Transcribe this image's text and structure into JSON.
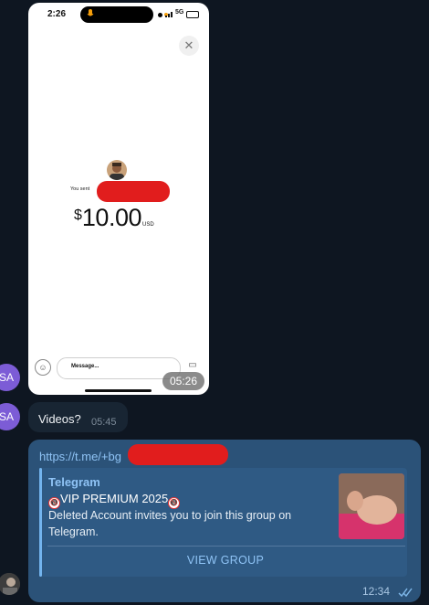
{
  "screenshot": {
    "status_time": "2:26",
    "network": "5G",
    "close_icon": "close-icon",
    "you_sent_label": "You sent",
    "currency_symbol": "$",
    "amount": "10.00",
    "currency_code": "USD",
    "message_placeholder": "Message...",
    "timestamp": "05:26"
  },
  "avatars": {
    "sa_initials_1": "SA",
    "sa_initials_2": "SA"
  },
  "message_videos": {
    "text": "Videos?",
    "time": "05:45"
  },
  "link_message": {
    "url_prefix": "https://t.me/+bg",
    "preview": {
      "site": "Telegram",
      "badge": "🔞",
      "title": "VIP PREMIUM 2025",
      "description": "Deleted Account invites you to join this group on Telegram.",
      "action": "VIEW GROUP"
    },
    "time": "12:34",
    "read_status_icon": "double-check-icon"
  },
  "colors": {
    "background": "#0e1621",
    "incoming_bubble": "#182533",
    "outgoing_bubble": "#2b5278",
    "link": "#8fc3f5",
    "redaction": "#e11d1d"
  }
}
